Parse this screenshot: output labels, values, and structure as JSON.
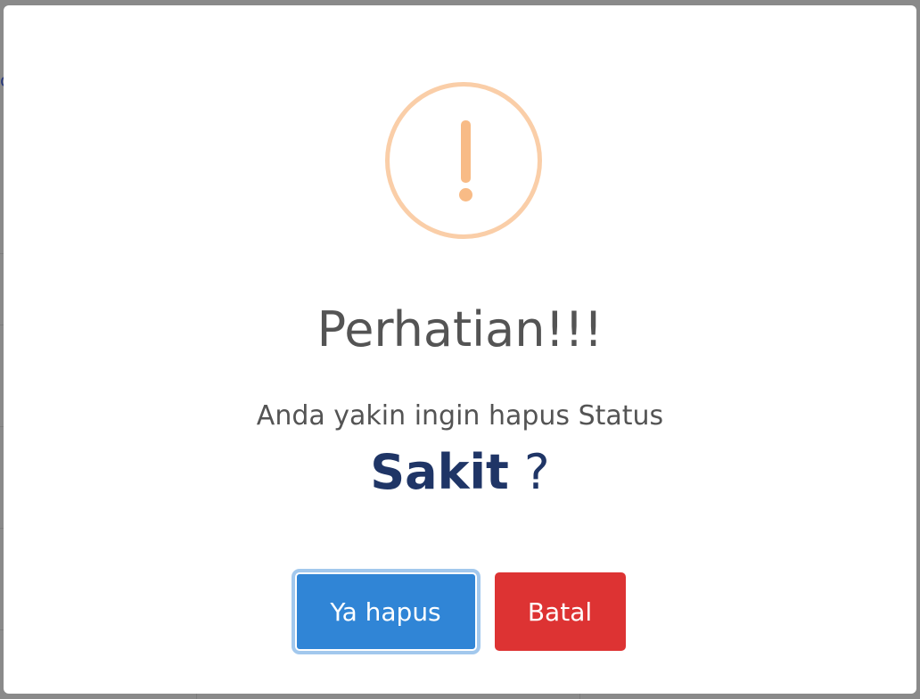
{
  "background": {
    "fragment_text": "c"
  },
  "dialog": {
    "icon": "warning-exclamation-icon",
    "title": "Perhatian!!!",
    "message": "Anda yakin ingin hapus Status",
    "subject": "Sakit",
    "question_mark": "?",
    "confirm_label": "Ya hapus",
    "cancel_label": "Batal"
  },
  "colors": {
    "icon_ring": "#facea8",
    "icon_mark": "#f8bb86",
    "subject": "#1f3566",
    "confirm": "#3085d6",
    "cancel": "#dd3333"
  }
}
